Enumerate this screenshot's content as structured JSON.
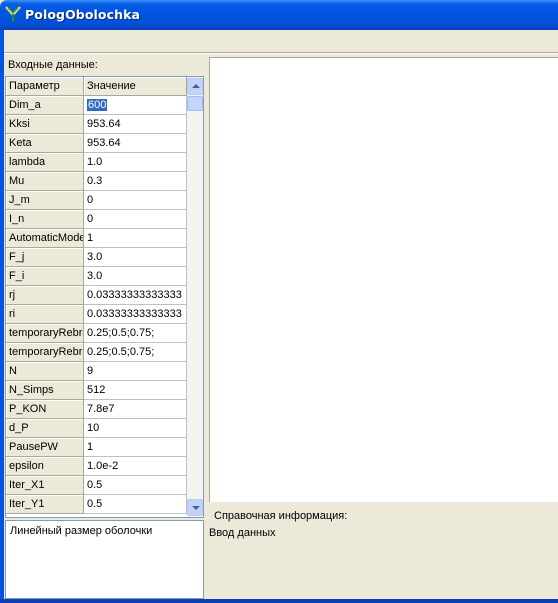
{
  "window": {
    "title": "PologObolochka",
    "icon": "app-logo-icon"
  },
  "input_panel": {
    "label": "Входные данные:",
    "columns": [
      "Параметр",
      "Значение"
    ],
    "rows": [
      {
        "name": "Dim_a",
        "value": "600",
        "selected": true
      },
      {
        "name": "Kksi",
        "value": "953.64"
      },
      {
        "name": "Keta",
        "value": "953.64"
      },
      {
        "name": "lambda",
        "value": "1.0"
      },
      {
        "name": "Mu",
        "value": "0.3"
      },
      {
        "name": "J_m",
        "value": "0"
      },
      {
        "name": "I_n",
        "value": "0"
      },
      {
        "name": "AutomaticMode",
        "value": "1"
      },
      {
        "name": "F_j",
        "value": "3.0"
      },
      {
        "name": "F_i",
        "value": "3.0"
      },
      {
        "name": "rj",
        "value": "0.03333333333333"
      },
      {
        "name": "ri",
        "value": "0.03333333333333"
      },
      {
        "name": "temporaryRebra",
        "value": "0.25;0.5;0.75;"
      },
      {
        "name": "temporaryRebra",
        "value": "0.25;0.5;0.75;"
      },
      {
        "name": "N",
        "value": "9"
      },
      {
        "name": "N_Simps",
        "value": "512"
      },
      {
        "name": "P_KON",
        "value": "7.8e7"
      },
      {
        "name": "d_P",
        "value": "10"
      },
      {
        "name": "PausePW",
        "value": "1"
      },
      {
        "name": "epsilon",
        "value": "1.0e-2"
      },
      {
        "name": "Iter_X1",
        "value": "0.5"
      },
      {
        "name": "Iter_Y1",
        "value": "0.5"
      }
    ],
    "description": "Линейный размер оболочки"
  },
  "info_panel": {
    "label": "Справочная информация:",
    "text": "Ввод данных"
  },
  "colors": {
    "titlebar": "#0054e3",
    "selection": "#316ac5",
    "face": "#ece9d8"
  }
}
